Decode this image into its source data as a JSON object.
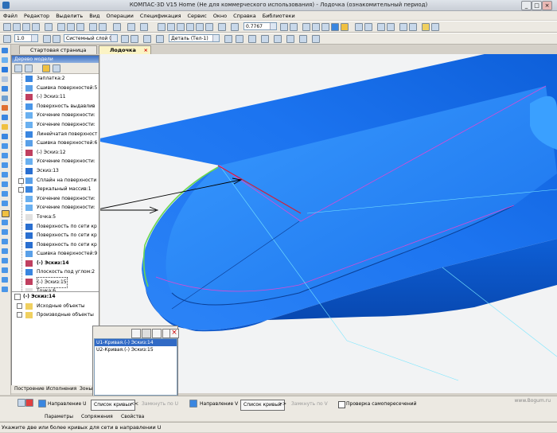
{
  "window": {
    "title": "КОМПАС-3D V15 Home (Не для коммерческого использования) - Лодочка (ознакомительный период)"
  },
  "menu": [
    "Файл",
    "Редактор",
    "Выделить",
    "Вид",
    "Операции",
    "Спецификация",
    "Сервис",
    "Окно",
    "Справка",
    "Библиотеки"
  ],
  "toolbar2": {
    "line_width": "1.0",
    "layer": "Системный слой (0)",
    "detail": "Деталь (Тел-1)"
  },
  "toolbar1": {
    "zoom": "0.7767"
  },
  "doc_tabs": [
    {
      "label": "Стартовая страница"
    },
    {
      "label": "Лодочка"
    }
  ],
  "tree": {
    "title": "Дерево модели",
    "items": [
      "Заплатка:2",
      "Сшивка поверхностей:5",
      "(-) Эскиз:11",
      "Поверхность выдавлив",
      "Усечение поверхности:",
      "Усечение поверхности:",
      "Линейчатая поверхност",
      "Сшивка поверхностей:6",
      "(-) Эскиз:12",
      "Усечение поверхности:",
      "Эскиз:13",
      "Сплайн на поверхности",
      "Зеркальный массив:1",
      "Усечение поверхности:",
      "Усечение поверхности:",
      "Точка:5",
      "Поверхность по сети кр",
      "Поверхность по сети кр",
      "Поверхность по сети кр",
      "Сшивка поверхностей:9",
      "(-) Эскиз:14",
      "Плоскость под углом:2",
      "(-) Эскиз:15",
      "Точка:6"
    ],
    "lower_title": "(-) Эскиз:14",
    "lower_items": [
      "Исходные объекты",
      "Производные объекты"
    ]
  },
  "bottom_tabs": [
    "Построение",
    "Исполнения",
    "Зоны"
  ],
  "curve_panel": {
    "items": [
      "U1-Кривая.(-) Эскиз:14",
      "U2-Кривая.(-) Эскиз:15"
    ]
  },
  "properties": {
    "dir_u": "Направление U",
    "list_curves_1": "Список кривых",
    "next_1": "<<",
    "close_u": "Замкнуть по U",
    "dir_v": "Направление V",
    "list_curves_2": "Список кривых",
    "next_2": ">>",
    "close_v": "Замкнуть по V",
    "check_self": "Проверка самопересечений"
  },
  "prop_tabs": [
    "Параметры",
    "Сопряжения",
    "Свойства"
  ],
  "status": "Укажите две или более кривых для сети в направлении U",
  "watermark": "www.Bogum.ru",
  "colors": {
    "body": "#1a6cf0",
    "edge_green": "#6ad650",
    "sketch_red": "#d0203a"
  }
}
